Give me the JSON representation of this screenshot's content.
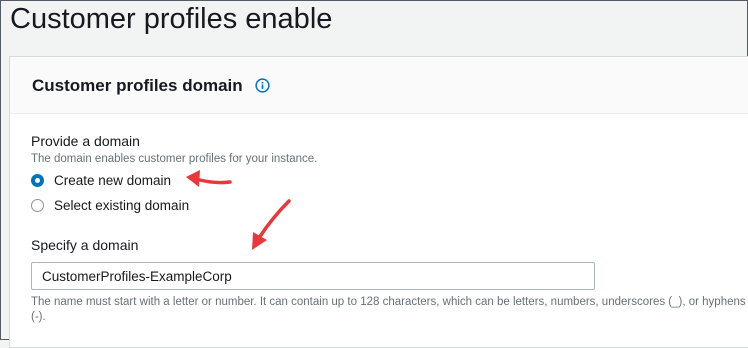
{
  "page": {
    "title": "Customer profiles enable"
  },
  "panel": {
    "title": "Customer profiles domain",
    "info_icon": "info-icon"
  },
  "domain_choice": {
    "label": "Provide a domain",
    "description": "The domain enables customer profiles for your instance.",
    "options": [
      {
        "label": "Create new domain",
        "selected": true
      },
      {
        "label": "Select existing domain",
        "selected": false
      }
    ]
  },
  "domain_field": {
    "label": "Specify a domain",
    "value": "CustomerProfiles-ExampleCorp",
    "constraint": "The name must start with a letter or number. It can contain up to 128 characters, which can be letters, numbers, underscores (_), or hyphens (-)."
  },
  "colors": {
    "accent": "#0073bb",
    "annotation_arrow": "#e8383b"
  }
}
